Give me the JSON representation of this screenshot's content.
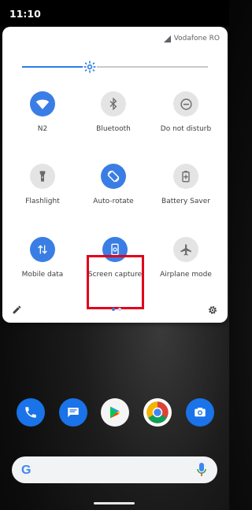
{
  "status_bar": {
    "time": "11:10"
  },
  "panel": {
    "carrier": "Vodafone RO",
    "brightness_level": 0.36,
    "tiles": [
      {
        "label": "N2",
        "icon": "wifi-icon",
        "active": true
      },
      {
        "label": "Bluetooth",
        "icon": "bluetooth-icon",
        "active": false
      },
      {
        "label": "Do not disturb",
        "icon": "do-not-disturb-icon",
        "active": false
      },
      {
        "label": "Flashlight",
        "icon": "flashlight-icon",
        "active": false
      },
      {
        "label": "Auto-rotate",
        "icon": "auto-rotate-icon",
        "active": true
      },
      {
        "label": "Battery Saver",
        "icon": "battery-saver-icon",
        "active": false
      },
      {
        "label": "Mobile data",
        "icon": "mobile-data-icon",
        "active": true
      },
      {
        "label": "Screen capture",
        "icon": "screen-capture-icon",
        "active": true
      },
      {
        "label": "Airplane mode",
        "icon": "airplane-icon",
        "active": false
      }
    ],
    "page_indicator": {
      "pages": 2,
      "current": 1
    }
  },
  "dock": {
    "apps": [
      "phone-icon",
      "messages-icon",
      "play-store-icon",
      "chrome-icon",
      "camera-icon"
    ]
  },
  "colors": {
    "accent": "#3a7ee5",
    "tile_off": "#e4e4e4",
    "highlight": "#e2001a"
  }
}
